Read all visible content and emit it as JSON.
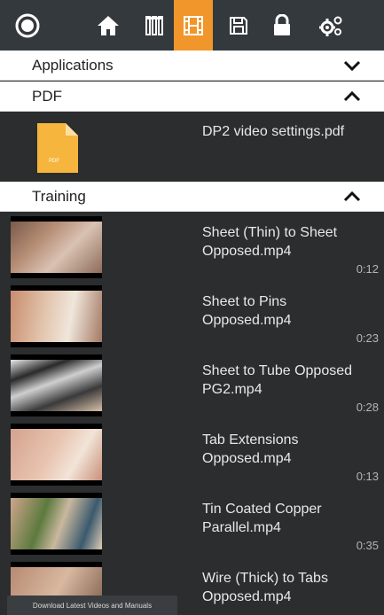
{
  "toolbar": {
    "buttons": [
      {
        "icon": "record-icon"
      },
      {
        "icon": "home-icon"
      },
      {
        "icon": "test-tubes-icon"
      },
      {
        "icon": "film-icon",
        "active": true
      },
      {
        "icon": "save-icon"
      },
      {
        "icon": "lock-icon"
      },
      {
        "icon": "gears-icon"
      }
    ],
    "accent_color": "#f0962a"
  },
  "sections": {
    "applications": {
      "label": "Applications",
      "state": "collapsed"
    },
    "pdf": {
      "label": "PDF",
      "state": "expanded"
    },
    "training": {
      "label": "Training",
      "state": "expanded"
    }
  },
  "pdf": {
    "files": [
      {
        "name": "DP2 video settings.pdf",
        "icon_label": "PDF"
      }
    ]
  },
  "training": {
    "videos": [
      {
        "title": "Sheet (Thin) to Sheet Opposed.mp4",
        "duration": "0:12"
      },
      {
        "title": "Sheet to Pins Opposed.mp4",
        "duration": "0:23"
      },
      {
        "title": "Sheet to Tube Opposed PG2.mp4",
        "duration": "0:28"
      },
      {
        "title": "Tab Extensions Opposed.mp4",
        "duration": "0:13"
      },
      {
        "title": "Tin Coated Copper Parallel.mp4",
        "duration": "0:35"
      },
      {
        "title": "Wire (Thick) to Tabs Opposed.mp4",
        "duration": ""
      }
    ]
  },
  "footer": {
    "label": "Download Latest Videos and Manuals"
  }
}
